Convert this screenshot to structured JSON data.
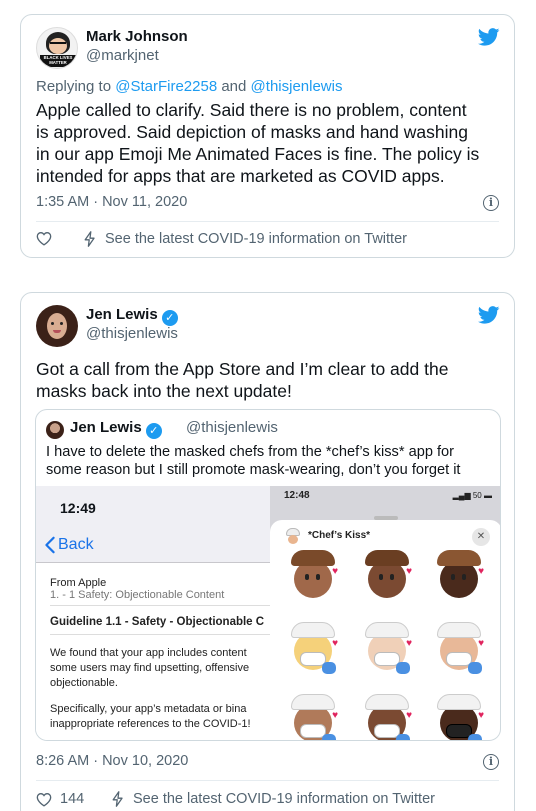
{
  "tweet1": {
    "name": "Mark Johnson",
    "handle": "@markjnet",
    "avatar_badge_lines": [
      "BLACK LIVES",
      "MATTER"
    ],
    "replying_prefix": "Replying to ",
    "replying_user1": "@StarFire2258",
    "replying_and": " and ",
    "replying_user2": "@thisjenlewis",
    "text_lines": [
      "Apple called to clarify. Said there is no problem, content",
      "is approved. Said depiction of masks and hand washing",
      "in our app Emoji Me Animated Faces is fine. The policy is",
      "intended for apps that are marketed as COVID apps."
    ],
    "timestamp": "1:35 AM · Nov 11, 2020",
    "covid_link": "See the latest COVID-19 information on Twitter"
  },
  "tweet2": {
    "name": "Jen Lewis",
    "handle": "@thisjenlewis",
    "text_lines": [
      "Got a call from the App Store and I’m clear to add the",
      "masks back into the next update!"
    ],
    "quote": {
      "name": "Jen Lewis",
      "handle": "@thisjenlewis",
      "text_lines": [
        "I have to delete the masked chefs from the *chef’s kiss* app for",
        "some reason but I still promote mask-wearing, don’t you forget it"
      ],
      "left_screenshot": {
        "time": "12:49",
        "back_label": "Back",
        "from_label": "From  Apple",
        "section_label": "1. - 1 Safety: Objectionable Content",
        "guideline_title": "Guideline 1.1 - Safety - Objectionable C",
        "para1_lines": [
          "We found that your app includes content",
          "some users may find upsetting, offensive",
          "objectionable."
        ],
        "para2_lines": [
          "Specifically, your app’s metadata or bina",
          "inappropriate references to the COVID-1!"
        ]
      },
      "right_screenshot": {
        "time": "12:48",
        "status": "50",
        "sheet_title": "*Chef’s Kiss*",
        "close_symbol": "✕"
      }
    },
    "timestamp": "8:26 AM · Nov 10, 2020",
    "like_count": "144",
    "covid_link": "See the latest COVID-19 information on Twitter"
  },
  "icons": {
    "twitter_bird": "twitter-bird-icon",
    "info": "info-icon",
    "heart": "heart-icon",
    "lightning": "lightning-icon",
    "verified": "verified-badge-icon"
  },
  "colors": {
    "twitter_blue": "#1d9bf0",
    "text_secondary": "#536471",
    "border": "#cfd9de"
  }
}
